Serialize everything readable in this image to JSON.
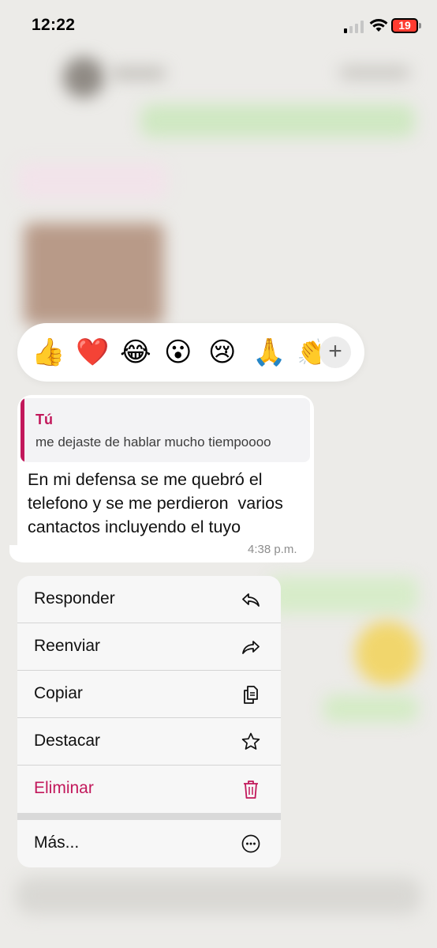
{
  "status_bar": {
    "time": "12:22",
    "battery": "19"
  },
  "reactions": {
    "emojis": [
      "👍",
      "❤️",
      "😂",
      "😮",
      "😢",
      "🙏",
      "👏"
    ],
    "add_label": "+"
  },
  "message": {
    "quote_author": "Tú",
    "quote_text": "me dejaste de hablar mucho tiempoooo",
    "lines": [
      "En mi defensa se me quebró el",
      "telefono y se me perdieron  varios",
      "cantactos incluyendo el tuyo"
    ],
    "time": "4:38 p.m."
  },
  "menu": {
    "responder": "Responder",
    "reenviar": "Reenviar",
    "copiar": "Copiar",
    "destacar": "Destacar",
    "eliminar": "Eliminar",
    "mas": "Más...",
    "danger_color": "#c2185b"
  }
}
